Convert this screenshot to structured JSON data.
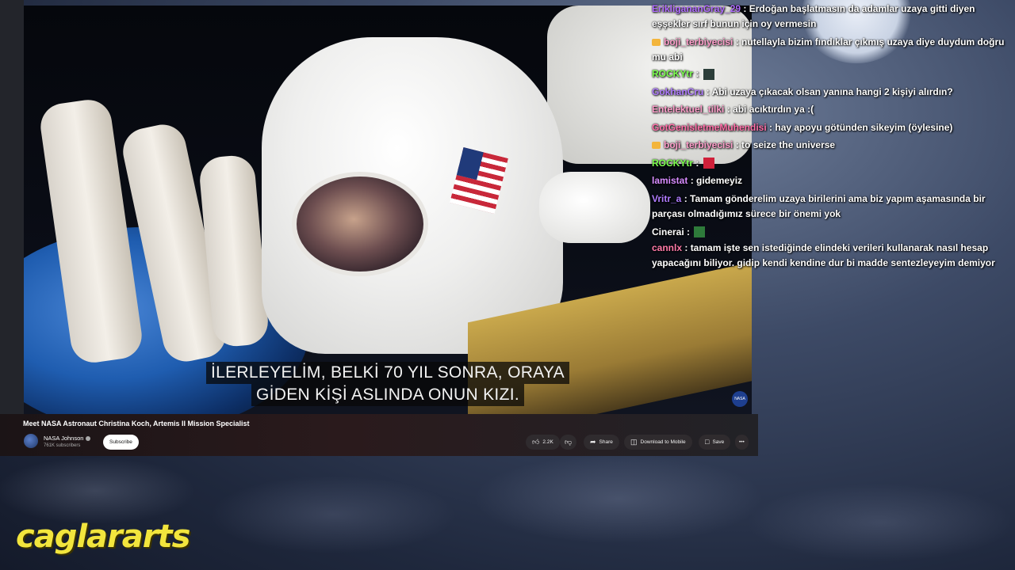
{
  "video": {
    "subtitle_line1": "İLERLEYELİM, BELKİ 70 YIL SONRA, ORAYA",
    "subtitle_line2": "GİDEN KİŞİ ASLINDA ONUN KIZI.",
    "corner_logo": "NASA",
    "title": "Meet NASA Astronaut Christina Koch, Artemis II Mission Specialist",
    "channel_name": "NASA Johnson",
    "subscribers": "761K subscribers",
    "subscribe_label": "Subscribe",
    "likes": "2.2K",
    "share_label": "Share",
    "download_label": "Download to Mobile",
    "save_label": "Save",
    "more_label": "•••"
  },
  "chat": [
    {
      "user": "ErikligananGray_29",
      "color": "#b06cff",
      "badge": false,
      "text": "Erdoğan başlatmasın da adamlar uzaya gitti diyen eşşekler sırf bunun için oy vermesin"
    },
    {
      "user": "boji_terbiyecisi",
      "color": "#ff9ecb",
      "badge": true,
      "text": "nutellayla bizim fındıklar çıkmış uzaya diye duydum doğru mu abi"
    },
    {
      "user": "ROCKYtr",
      "color": "#7cff4f",
      "badge": false,
      "text": "",
      "emote": "#2c3e3a"
    },
    {
      "user": "GokhanCru",
      "color": "#b07cff",
      "badge": false,
      "text": "Abi uzaya çıkacak olsan yanına hangi 2 kişiyi alırdın?"
    },
    {
      "user": "Entelektuel_tilki",
      "color": "#ff9ecb",
      "badge": false,
      "text": "abi acıktırdın ya :("
    },
    {
      "user": "GotGenisletmeMuhendisi",
      "color": "#ff6fa8",
      "badge": false,
      "text": "hay apoyu götünden sikeyim (öylesine)"
    },
    {
      "user": "boji_terbiyecisi",
      "color": "#ff9ecb",
      "badge": true,
      "text": "to seize the universe"
    },
    {
      "user": "ROCKYtr",
      "color": "#7cff4f",
      "badge": false,
      "text": "",
      "emote": "#d0203a"
    },
    {
      "user": "lamistat",
      "color": "#d78cff",
      "badge": false,
      "text": "gidemeyiz"
    },
    {
      "user": "Vritr_a",
      "color": "#b07cff",
      "badge": false,
      "text": "Tamam gönderelim uzaya birilerini ama biz yapım aşamasında bir parçası olmadığımız sürece bir önemi yok"
    },
    {
      "user": "Cinerai",
      "color": "#ffffff",
      "badge": false,
      "text": "",
      "emote": "#2e7a3a"
    },
    {
      "user": "cannlx",
      "color": "#ff7aa8",
      "badge": false,
      "text": "tamam işte sen istediğinde elindeki verileri kullanarak nasıl hesap yapacağını biliyor. gidip kendi kendine dur bi madde sentezleyeyim demiyor"
    }
  ],
  "brand": "caglararts"
}
